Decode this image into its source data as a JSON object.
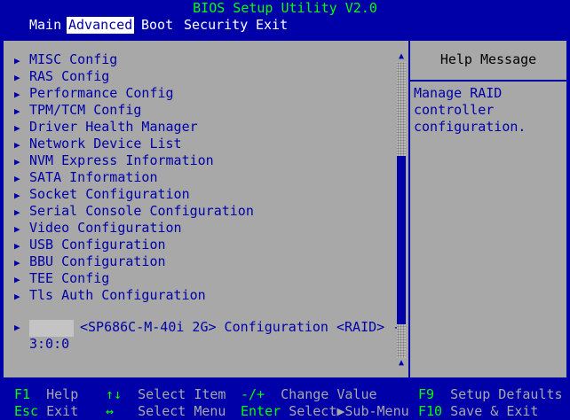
{
  "title": "BIOS Setup Utility V2.0",
  "menu": {
    "main": "Main",
    "advanced": "Advanced",
    "boot": "Boot",
    "security": "Security",
    "exit": "Exit"
  },
  "items": [
    "MISC Config",
    "RAS Config",
    "Performance Config",
    "TPM/TCM Config",
    "Driver Health Manager",
    "Network Device List",
    "NVM Express Information",
    "SATA Information",
    "Socket Configuration",
    "Serial Console Configuration",
    "Video Configuration",
    "USB Configuration",
    "BBU Configuration",
    "TEE Config",
    "Tls Auth Configuration"
  ],
  "raid_item": {
    "line1": "<SP686C-M-40i 2G> Configuration <RAID> -",
    "line2": "3:0:0"
  },
  "arrow_glyph": "▶",
  "scroll": {
    "up": "▲",
    "down": "▲"
  },
  "help": {
    "title": "Help Message",
    "text": "Manage RAID\ncontroller\nconfiguration."
  },
  "footer": {
    "f1_key": "F1",
    "f1_desc": "Help",
    "arrows_key": "↑↓",
    "arrows_desc": "Select Item",
    "minus_key": "-/+",
    "minus_desc": "Change Value",
    "f9_key": "F9",
    "f9_desc": "Setup Defaults",
    "esc_key": "Esc",
    "esc_desc": "Exit",
    "lr_key": "↔",
    "lr_desc": "Select Menu",
    "enter_key": "Enter",
    "enter_desc": "Select▶Sub-Menu",
    "f10_key": "F10",
    "f10_desc": "Save & Exit"
  }
}
